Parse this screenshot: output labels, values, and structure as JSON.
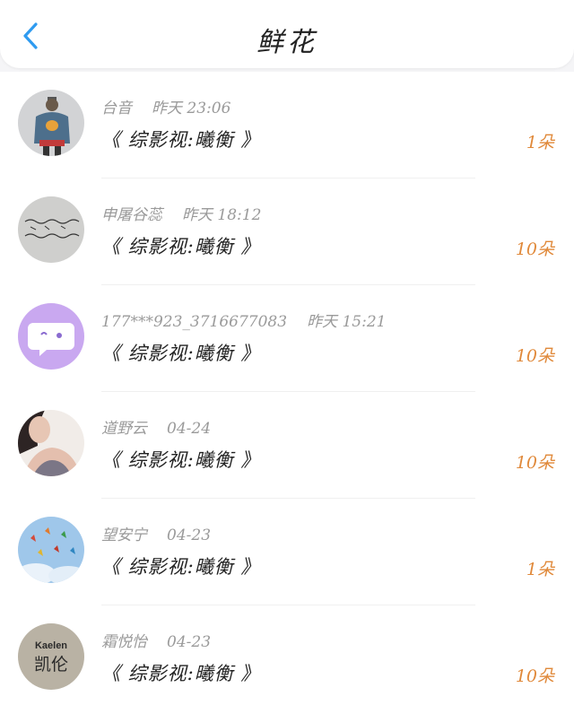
{
  "header": {
    "title": "鲜花",
    "back_icon": "chevron-left-icon",
    "accent": "#2f9bf0"
  },
  "colors": {
    "count": "#e0893a",
    "meta": "#9a9a9a"
  },
  "rows": [
    {
      "name": "台音",
      "time": "昨天 23:06",
      "work": "《 综影视:曦衡 》",
      "count": "1朵",
      "avatar": "avatar-denim-jacket"
    },
    {
      "name": "申屠谷蕊",
      "time": "昨天 18:12",
      "work": "《 综影视:曦衡 》",
      "count": "10朵",
      "avatar": "avatar-handwriting"
    },
    {
      "name": "177***923_3716677083",
      "time": "昨天 15:21",
      "work": "《 综影视:曦衡 》",
      "count": "10朵",
      "avatar": "avatar-purple-chat"
    },
    {
      "name": "道野云",
      "time": "04-24",
      "work": "《 综影视:曦衡 》",
      "count": "10朵",
      "avatar": "avatar-portrait"
    },
    {
      "name": "望安宁",
      "time": "04-23",
      "work": "《 综影视:曦衡 》",
      "count": "1朵",
      "avatar": "avatar-paper-cranes"
    },
    {
      "name": "霜悦怡",
      "time": "04-23",
      "work": "《 综影视:曦衡 》",
      "count": "10朵",
      "avatar": "avatar-kaelen-text",
      "avatar_text_en": "Kaelen",
      "avatar_text_cn": "凯伦"
    }
  ]
}
